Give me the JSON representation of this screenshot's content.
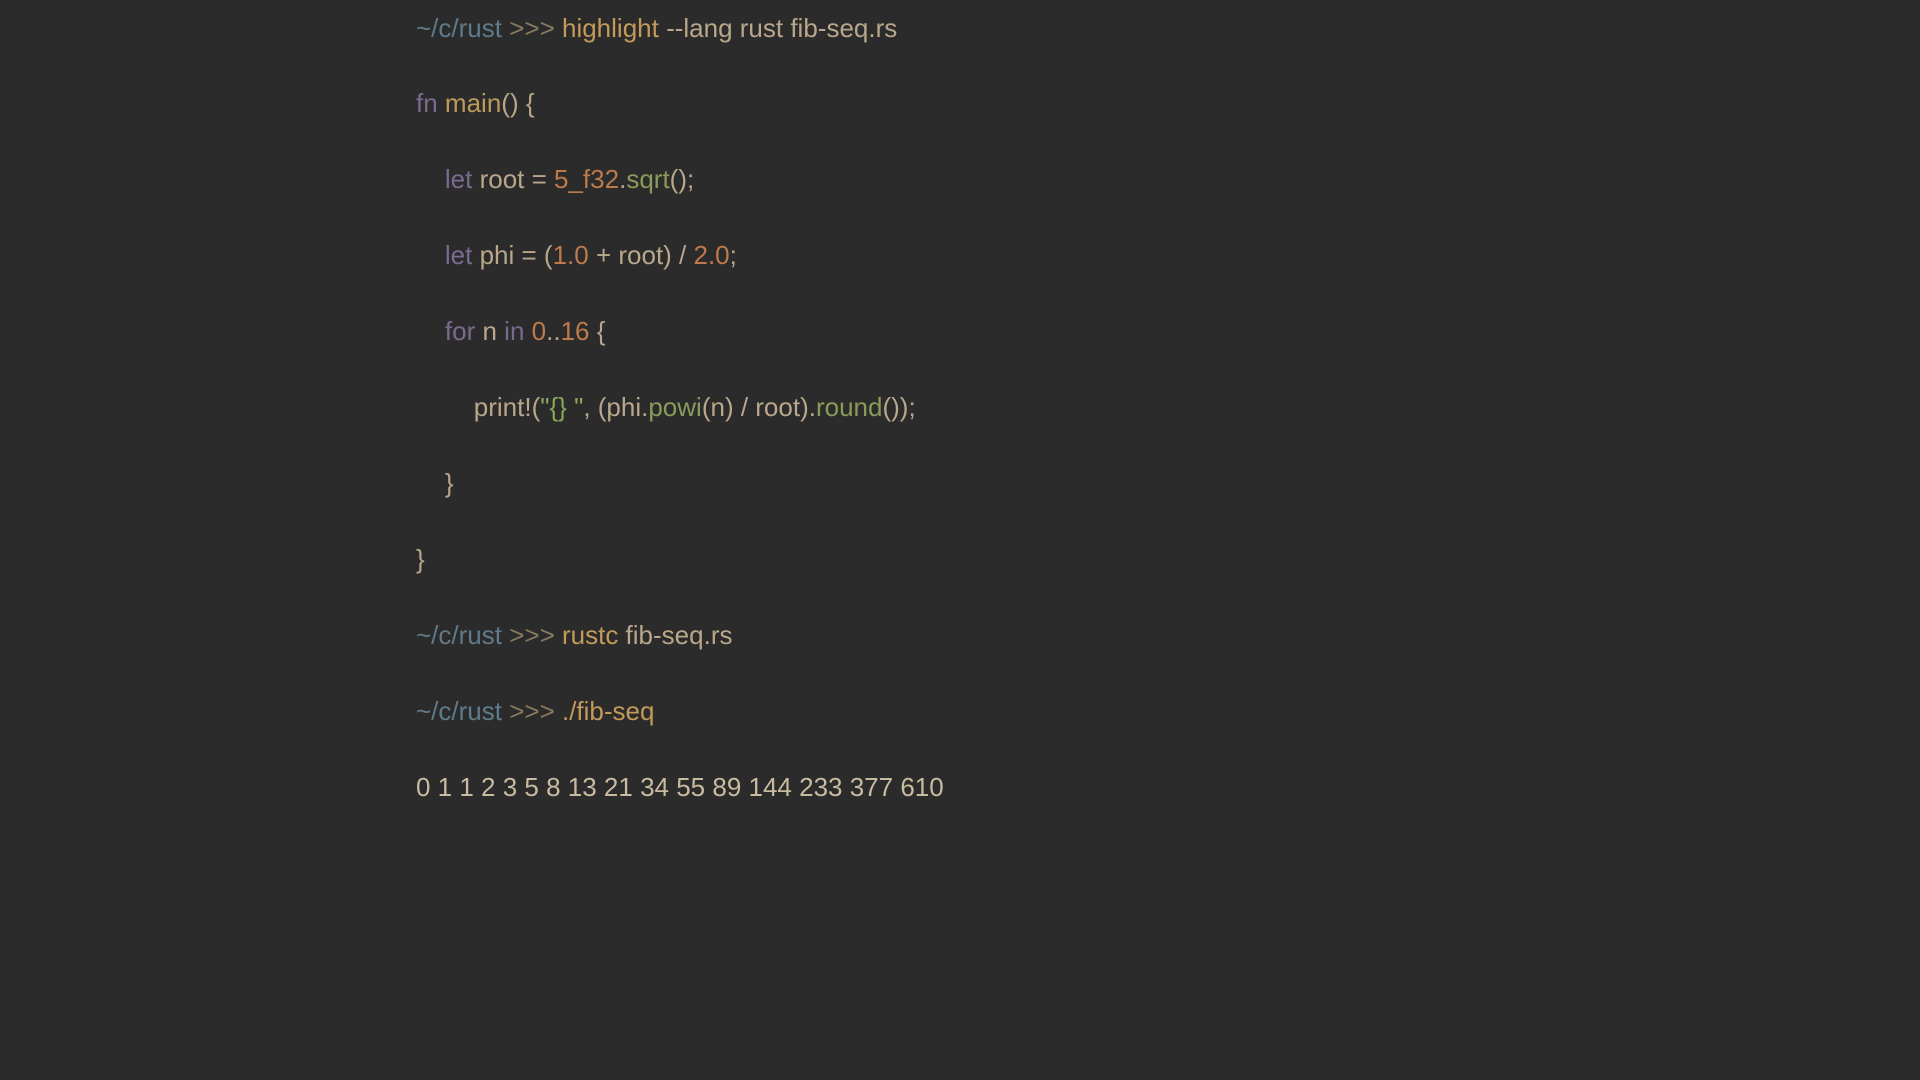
{
  "line1": {
    "path": "~/c/rust",
    "arrows": " >>> ",
    "cmd": "highlight",
    "args": " --lang rust fib-seq.rs"
  },
  "code": {
    "l1_kw": "fn ",
    "l1_fn": "main",
    "l1_rest": "() {",
    "l2_kw": "    let",
    "l2_a": " root = ",
    "l2_num": "5_f32",
    "l2_b": ".",
    "l2_meth": "sqrt",
    "l2_c": "();",
    "l3_kw": "    let",
    "l3_a": " phi = (",
    "l3_n1": "1.0",
    "l3_b": " + root) / ",
    "l3_n2": "2.0",
    "l3_c": ";",
    "l4_kw1": "    for",
    "l4_a": " n ",
    "l4_kw2": "in",
    "l4_b": " ",
    "l4_n1": "0",
    "l4_c": "..",
    "l4_n2": "16",
    "l4_d": " {",
    "l5_a": "        print!(",
    "l5_str": "\"{} \"",
    "l5_b": ", (phi.",
    "l5_m1": "powi",
    "l5_c": "(n) / root).",
    "l5_m2": "round",
    "l5_d": "());",
    "l6": "    }",
    "l7": "}"
  },
  "line2": {
    "path": "~/c/rust",
    "arrows": " >>> ",
    "cmd": "rustc",
    "args": " fib-seq.rs"
  },
  "line3": {
    "path": "~/c/rust",
    "arrows": " >>> ",
    "cmd": "./fib-seq"
  },
  "output": "0 1 1 2 3 5 8 13 21 34 55 89 144 233 377 610 "
}
